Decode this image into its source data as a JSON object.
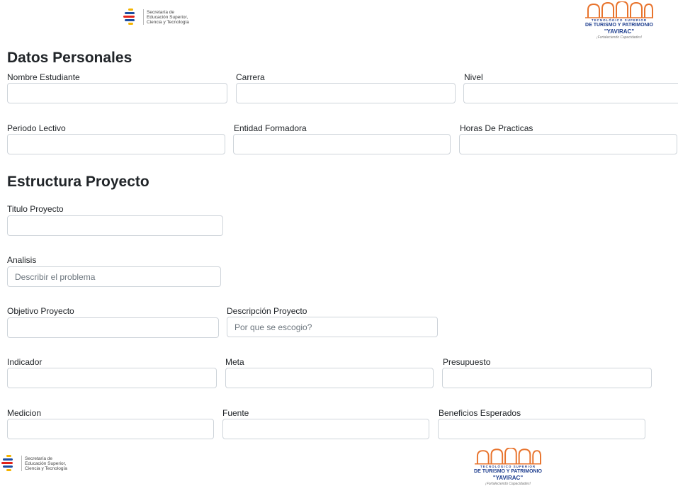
{
  "logos": {
    "ministry_lines": [
      "Secretaría de",
      "Educación Superior,",
      "Ciencia y Tecnología"
    ],
    "institute_line1": "TECNOLÓGICO SUPERIOR",
    "institute_line2": "DE TURISMO Y PATRIMONIO",
    "institute_line3": "\"YAVIRAC\"",
    "institute_tagline": "¡Fortaleciendo Capacidades!",
    "colors": {
      "blue": "#1f3f8f",
      "orange": "#e8732c"
    }
  },
  "datos_personales": {
    "heading": "Datos Personales",
    "nombre_label": "Nombre Estudiante",
    "carrera_label": "Carrera",
    "nivel_label": "Nivel",
    "periodo_label": "Periodo Lectivo",
    "entidad_label": "Entidad Formadora",
    "horas_label": "Horas De Practicas"
  },
  "estructura": {
    "heading": "Estructura Proyecto",
    "titulo_label": "Titulo Proyecto",
    "analisis_label": "Analisis",
    "analisis_placeholder": "Describir el problema",
    "objetivo_label": "Objetivo Proyecto",
    "descripcion_label": "Descripción Proyecto",
    "descripcion_placeholder": "Por que se escogio?",
    "indicador_label": "Indicador",
    "meta_label": "Meta",
    "presupuesto_label": "Presupuesto",
    "medicion_label": "Medicion",
    "fuente_label": "Fuente",
    "beneficios_label": "Beneficios Esperados"
  }
}
